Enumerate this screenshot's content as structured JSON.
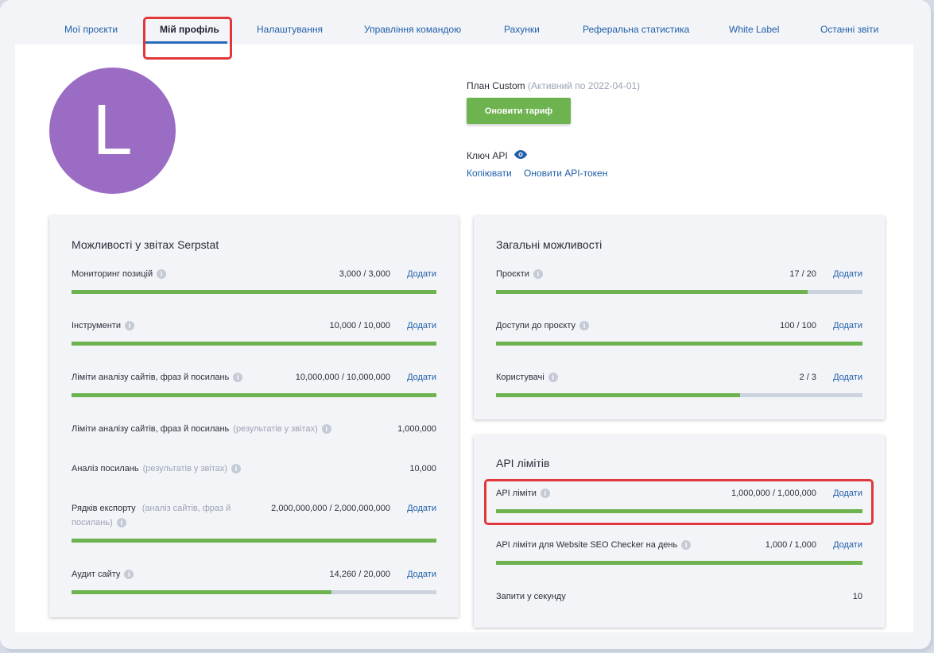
{
  "tabs": [
    {
      "label": "Мої проєкти"
    },
    {
      "label": "Мій профіль"
    },
    {
      "label": "Налаштування"
    },
    {
      "label": "Управління командою"
    },
    {
      "label": "Рахунки"
    },
    {
      "label": "Реферальна статистика"
    },
    {
      "label": "White Label"
    },
    {
      "label": "Останні звіти"
    }
  ],
  "profile": {
    "avatar_letter": "L",
    "avatar_color": "#9b6cc4",
    "plan_label": "План",
    "plan_name": "Custom",
    "plan_status": "(Активний по 2022-04-01)",
    "upgrade_button": "Оновити тариф",
    "api_key_label": "Ключ API",
    "copy_link": "Копіювати",
    "refresh_token_link": "Оновити API-токен"
  },
  "report_features": {
    "title": "Можливості у звітах Serpstat",
    "rows": [
      {
        "label": "Мониторинг позицій",
        "sub": "",
        "value": "3,000 / 3,000",
        "add": "Додати",
        "fill": 1.0
      },
      {
        "label": "Інструменти",
        "sub": "",
        "value": "10,000 / 10,000",
        "add": "Додати",
        "fill": 1.0
      },
      {
        "label": "Ліміти аналізу сайтів, фраз й посилань",
        "sub": "",
        "value": "10,000,000 / 10,000,000",
        "add": "Додати",
        "fill": 1.0
      },
      {
        "label": "Ліміти аналізу сайтів, фраз й посилань",
        "sub": "(результатів у звітах)",
        "value": "1,000,000"
      },
      {
        "label": "Аналіз посилань",
        "sub": "(результатів у звітах)",
        "value": "10,000"
      },
      {
        "label": "Рядків експорту",
        "sub": "(аналіз сайтів, фраз й",
        "sub2": "посилань)",
        "value": "2,000,000,000 / 2,000,000,000",
        "add": "Додати",
        "fill": 1.0
      },
      {
        "label": "Аудит сайту",
        "sub": "",
        "value": "14,260 / 20,000",
        "add": "Додати",
        "fill": 0.713
      }
    ]
  },
  "general_features": {
    "title": "Загальні можливості",
    "rows": [
      {
        "label": "Проєкти",
        "value": "17 / 20",
        "add": "Додати",
        "fill": 0.85
      },
      {
        "label": "Доступи до проєкту",
        "value": "100 / 100",
        "add": "Додати",
        "fill": 1.0
      },
      {
        "label": "Користувачі",
        "value": "2 / 3",
        "add": "Додати",
        "fill": 0.667
      }
    ]
  },
  "api_limits": {
    "title": "API лімітів",
    "rows": [
      {
        "label": "API ліміти",
        "value": "1,000,000 / 1,000,000",
        "add": "Додати",
        "fill": 1.0
      },
      {
        "label": "API ліміти для Website SEO Checker на день",
        "value": "1,000 / 1,000",
        "add": "Додати",
        "fill": 1.0
      },
      {
        "label": "Запити у секунду",
        "value": "10"
      }
    ]
  },
  "colors": {
    "accent": "#1f5fa8",
    "progress": "#6db34f",
    "highlight": "#e0373b"
  }
}
